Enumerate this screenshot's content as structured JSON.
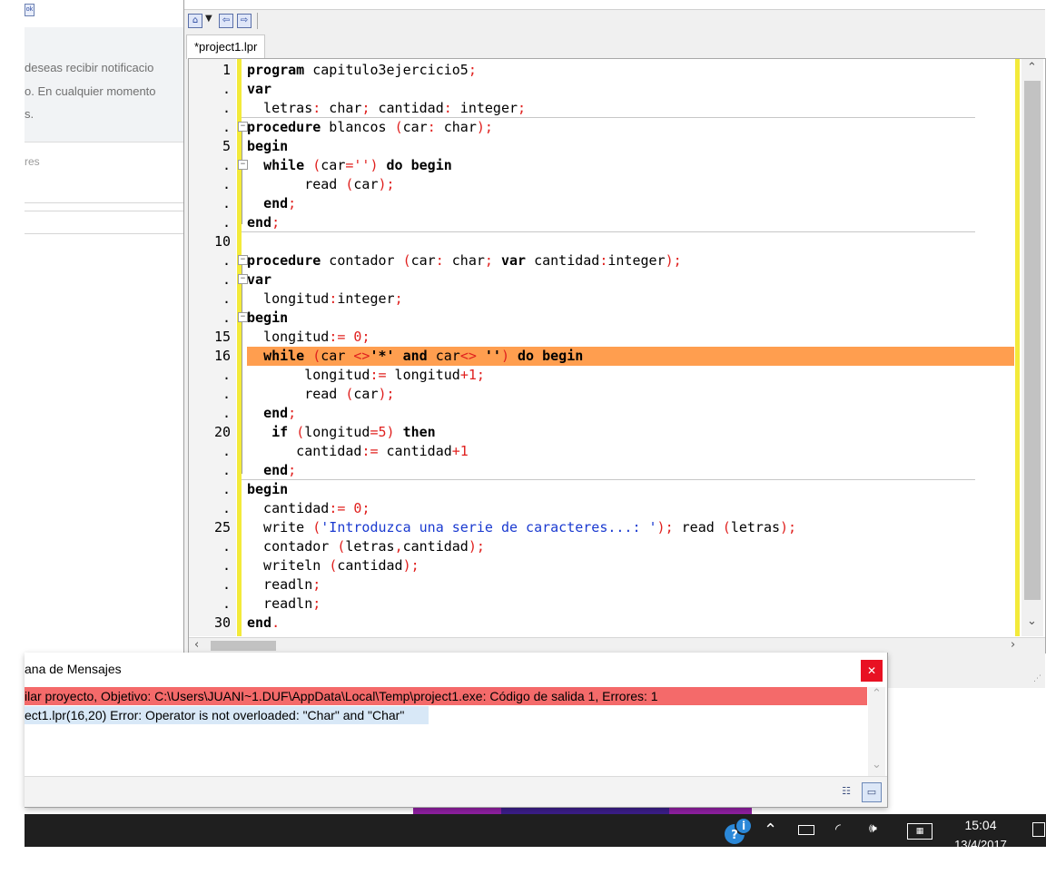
{
  "browser_fragment": {
    "notification_lines": [
      "deseas recibir notificacio",
      "o. En cualquier momento",
      "s."
    ],
    "label": "res"
  },
  "editor": {
    "tab_label": "*project1.lpr",
    "toolbar": {
      "home_icon": "home-icon",
      "dropdown_icon": "dropdown-arrow-icon",
      "back_icon": "jump-back-icon",
      "forward_icon": "jump-forward-icon"
    },
    "line_markers": [
      "1",
      ".",
      ".",
      ".",
      "5",
      ".",
      ".",
      ".",
      ".",
      "10",
      ".",
      ".",
      ".",
      ".",
      "15",
      "16",
      ".",
      ".",
      ".",
      "20",
      ".",
      ".",
      ".",
      ".",
      "25",
      ".",
      ".",
      ".",
      ".",
      "30"
    ],
    "highlighted_line": 16,
    "code_lines": [
      {
        "parts": [
          {
            "t": "program",
            "k": "kw"
          },
          {
            "t": " capitulo3ejercicio5",
            "k": ""
          },
          {
            "t": ";",
            "k": "sym"
          }
        ]
      },
      {
        "parts": [
          {
            "t": "var",
            "k": "kw"
          }
        ]
      },
      {
        "parts": [
          {
            "t": "  letras",
            "k": ""
          },
          {
            "t": ":",
            "k": "sym"
          },
          {
            "t": " char",
            "k": ""
          },
          {
            "t": ";",
            "k": "sym"
          },
          {
            "t": " cantidad",
            "k": ""
          },
          {
            "t": ":",
            "k": "sym"
          },
          {
            "t": " integer",
            "k": ""
          },
          {
            "t": ";",
            "k": "sym"
          }
        ]
      },
      {
        "parts": [
          {
            "t": "procedure",
            "k": "kw"
          },
          {
            "t": " blancos ",
            "k": ""
          },
          {
            "t": "(",
            "k": "sym"
          },
          {
            "t": "car",
            "k": ""
          },
          {
            "t": ":",
            "k": "sym"
          },
          {
            "t": " char",
            "k": ""
          },
          {
            "t": ");",
            "k": "sym"
          }
        ]
      },
      {
        "parts": [
          {
            "t": "begin",
            "k": "kw"
          }
        ]
      },
      {
        "parts": [
          {
            "t": "  ",
            "k": ""
          },
          {
            "t": "while",
            "k": "kw"
          },
          {
            "t": " ",
            "k": ""
          },
          {
            "t": "(",
            "k": "sym"
          },
          {
            "t": "car",
            "k": ""
          },
          {
            "t": "=''",
            "k": "sym"
          },
          {
            "t": ")",
            "k": "sym"
          },
          {
            "t": " ",
            "k": ""
          },
          {
            "t": "do",
            "k": "kw"
          },
          {
            "t": " ",
            "k": ""
          },
          {
            "t": "begin",
            "k": "kw"
          }
        ]
      },
      {
        "parts": [
          {
            "t": "       read ",
            "k": ""
          },
          {
            "t": "(",
            "k": "sym"
          },
          {
            "t": "car",
            "k": ""
          },
          {
            "t": ");",
            "k": "sym"
          }
        ]
      },
      {
        "parts": [
          {
            "t": "  ",
            "k": ""
          },
          {
            "t": "end",
            "k": "kw"
          },
          {
            "t": ";",
            "k": "sym"
          }
        ]
      },
      {
        "parts": [
          {
            "t": "end",
            "k": "kw"
          },
          {
            "t": ";",
            "k": "sym"
          }
        ]
      },
      {
        "parts": []
      },
      {
        "parts": [
          {
            "t": "procedure",
            "k": "kw"
          },
          {
            "t": " contador ",
            "k": ""
          },
          {
            "t": "(",
            "k": "sym"
          },
          {
            "t": "car",
            "k": ""
          },
          {
            "t": ":",
            "k": "sym"
          },
          {
            "t": " char",
            "k": ""
          },
          {
            "t": ";",
            "k": "sym"
          },
          {
            "t": " ",
            "k": ""
          },
          {
            "t": "var",
            "k": "kw"
          },
          {
            "t": " cantidad",
            "k": ""
          },
          {
            "t": ":",
            "k": "sym"
          },
          {
            "t": "integer",
            "k": ""
          },
          {
            "t": ");",
            "k": "sym"
          }
        ]
      },
      {
        "parts": [
          {
            "t": "var",
            "k": "kw"
          }
        ]
      },
      {
        "parts": [
          {
            "t": "  longitud",
            "k": ""
          },
          {
            "t": ":",
            "k": "sym"
          },
          {
            "t": "integer",
            "k": ""
          },
          {
            "t": ";",
            "k": "sym"
          }
        ]
      },
      {
        "parts": [
          {
            "t": "begin",
            "k": "kw"
          }
        ]
      },
      {
        "parts": [
          {
            "t": "  longitud",
            "k": ""
          },
          {
            "t": ":=",
            "k": "sym"
          },
          {
            "t": " ",
            "k": ""
          },
          {
            "t": "0",
            "k": "sym"
          },
          {
            "t": ";",
            "k": "sym"
          }
        ]
      },
      {
        "parts": [
          {
            "t": "  ",
            "k": ""
          },
          {
            "t": "while",
            "k": "kw"
          },
          {
            "t": " ",
            "k": ""
          },
          {
            "t": "(",
            "k": "sym"
          },
          {
            "t": "car ",
            "k": ""
          },
          {
            "t": "<>",
            "k": "sym"
          },
          {
            "t": "'*'",
            "k": "kw"
          },
          {
            "t": " ",
            "k": ""
          },
          {
            "t": "and",
            "k": "kw"
          },
          {
            "t": " car",
            "k": ""
          },
          {
            "t": "<>",
            "k": "sym"
          },
          {
            "t": " ",
            "k": ""
          },
          {
            "t": "''",
            "k": "kw"
          },
          {
            "t": ")",
            "k": "sym"
          },
          {
            "t": " ",
            "k": ""
          },
          {
            "t": "do",
            "k": "kw"
          },
          {
            "t": " ",
            "k": ""
          },
          {
            "t": "begin",
            "k": "kw"
          }
        ]
      },
      {
        "parts": [
          {
            "t": "       longitud",
            "k": ""
          },
          {
            "t": ":=",
            "k": "sym"
          },
          {
            "t": " longitud",
            "k": ""
          },
          {
            "t": "+1",
            "k": "sym"
          },
          {
            "t": ";",
            "k": "sym"
          }
        ]
      },
      {
        "parts": [
          {
            "t": "       read ",
            "k": ""
          },
          {
            "t": "(",
            "k": "sym"
          },
          {
            "t": "car",
            "k": ""
          },
          {
            "t": ");",
            "k": "sym"
          }
        ]
      },
      {
        "parts": [
          {
            "t": "  ",
            "k": ""
          },
          {
            "t": "end",
            "k": "kw"
          },
          {
            "t": ";",
            "k": "sym"
          }
        ]
      },
      {
        "parts": [
          {
            "t": "   ",
            "k": ""
          },
          {
            "t": "if",
            "k": "kw"
          },
          {
            "t": " ",
            "k": ""
          },
          {
            "t": "(",
            "k": "sym"
          },
          {
            "t": "longitud",
            "k": ""
          },
          {
            "t": "=5",
            "k": "sym"
          },
          {
            "t": ")",
            "k": "sym"
          },
          {
            "t": " ",
            "k": ""
          },
          {
            "t": "then",
            "k": "kw"
          }
        ]
      },
      {
        "parts": [
          {
            "t": "      cantidad",
            "k": ""
          },
          {
            "t": ":=",
            "k": "sym"
          },
          {
            "t": " cantidad",
            "k": ""
          },
          {
            "t": "+1",
            "k": "sym"
          }
        ]
      },
      {
        "parts": [
          {
            "t": "  ",
            "k": ""
          },
          {
            "t": "end",
            "k": "kw"
          },
          {
            "t": ";",
            "k": "sym"
          }
        ]
      },
      {
        "parts": [
          {
            "t": "begin",
            "k": "kw"
          }
        ]
      },
      {
        "parts": [
          {
            "t": "  cantidad",
            "k": ""
          },
          {
            "t": ":=",
            "k": "sym"
          },
          {
            "t": " ",
            "k": ""
          },
          {
            "t": "0",
            "k": "sym"
          },
          {
            "t": ";",
            "k": "sym"
          }
        ]
      },
      {
        "parts": [
          {
            "t": "  write ",
            "k": ""
          },
          {
            "t": "(",
            "k": "sym"
          },
          {
            "t": "'Introduzca una serie de caracteres...: '",
            "k": "str"
          },
          {
            "t": ");",
            "k": "sym"
          },
          {
            "t": " read ",
            "k": ""
          },
          {
            "t": "(",
            "k": "sym"
          },
          {
            "t": "letras",
            "k": ""
          },
          {
            "t": ");",
            "k": "sym"
          }
        ]
      },
      {
        "parts": [
          {
            "t": "  contador ",
            "k": ""
          },
          {
            "t": "(",
            "k": "sym"
          },
          {
            "t": "letras",
            "k": ""
          },
          {
            "t": ",",
            "k": "sym"
          },
          {
            "t": "cantidad",
            "k": ""
          },
          {
            "t": ");",
            "k": "sym"
          }
        ]
      },
      {
        "parts": [
          {
            "t": "  writeln ",
            "k": ""
          },
          {
            "t": "(",
            "k": "sym"
          },
          {
            "t": "cantidad",
            "k": ""
          },
          {
            "t": ");",
            "k": "sym"
          }
        ]
      },
      {
        "parts": [
          {
            "t": "  readln",
            "k": ""
          },
          {
            "t": ";",
            "k": "sym"
          }
        ]
      },
      {
        "parts": [
          {
            "t": "  readln",
            "k": ""
          },
          {
            "t": ";",
            "k": "sym"
          }
        ]
      },
      {
        "parts": [
          {
            "t": "end",
            "k": "kw"
          },
          {
            "t": ".",
            "k": "sym"
          }
        ]
      }
    ]
  },
  "messages": {
    "title": "ana de Mensajes",
    "close_icon": "close-icon",
    "rows": [
      "ilar proyecto, Objetivo: C:\\Users\\JUANI~1.DUF\\AppData\\Local\\Temp\\project1.exe: Código de salida 1, Errores: 1",
      "ect1.lpr(16,20) Error: Operator is not overloaded: \"Char\" and \"Char\""
    ]
  },
  "taskbar": {
    "time": "15:04",
    "date": "13/4/2017",
    "icons": [
      "cortana-help-icon",
      "chevron-up-icon",
      "battery-icon",
      "wifi-icon",
      "volume-icon",
      "keyboard-icon",
      "notification-icon"
    ]
  },
  "colors": {
    "highlight": "#ff9e4f",
    "error_row": "#f46a6a",
    "selected_row": "#d8e8f7",
    "keyword": "#000000",
    "symbol": "#e0201e",
    "string": "#1a3ad0",
    "gutter_bar": "#f3ea3a"
  }
}
